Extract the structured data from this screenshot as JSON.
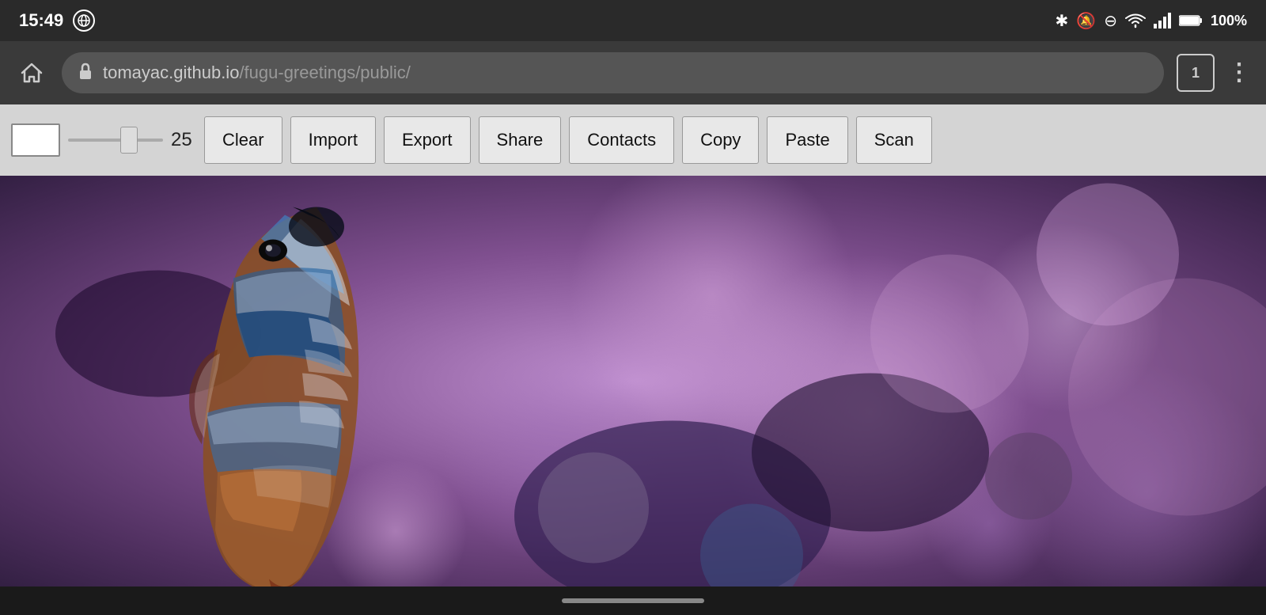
{
  "statusBar": {
    "time": "15:49",
    "batteryPercent": "100%",
    "icons": {
      "bluetooth": "✱",
      "mute": "🔔",
      "dnd": "⊖",
      "wifi": "▲",
      "signal": "▲",
      "battery": "🔋"
    }
  },
  "browserBar": {
    "homeIcon": "⌂",
    "lockIcon": "🔒",
    "urlBase": "tomayac.github.io",
    "urlPath": "/fugu-greetings/public/",
    "tabCount": "1",
    "menuIcon": "⋮"
  },
  "toolbar": {
    "sliderValue": "25",
    "buttons": {
      "clear": "Clear",
      "import": "Import",
      "export": "Export",
      "share": "Share",
      "contacts": "Contacts",
      "copy": "Copy",
      "paste": "Paste",
      "scan": "Scan"
    }
  },
  "bottomBar": {
    "homeIndicatorLabel": "home-indicator"
  }
}
